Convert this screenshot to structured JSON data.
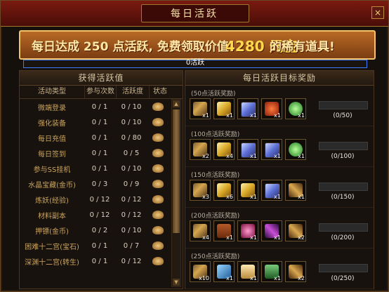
{
  "window": {
    "title": "每日活跃",
    "close_label": "×"
  },
  "banner": {
    "text_before": "每日达成 250 点活跃, 免费领取价值",
    "amount": "4280 元宝",
    "text_after": "的稀有道具!"
  },
  "activity_bar": {
    "label": "0活跃",
    "progress": 0
  },
  "left_panel": {
    "title": "获得活跃值",
    "columns": [
      "活动类型",
      "参与次数",
      "活跃度",
      "状态"
    ],
    "rows": [
      {
        "name": "微端登录",
        "count": "0 / 1",
        "activity": "0 / 10"
      },
      {
        "name": "强化装备",
        "count": "0 / 1",
        "activity": "0 / 10"
      },
      {
        "name": "每日充值",
        "count": "0 / 1",
        "activity": "0 / 80"
      },
      {
        "name": "每日签到",
        "count": "0 / 1",
        "activity": "0 / 5"
      },
      {
        "name": "参与SS挂机",
        "count": "0 / 1",
        "activity": "0 / 10"
      },
      {
        "name": "水晶宝藏(金币)",
        "count": "0 / 3",
        "activity": "0 / 9"
      },
      {
        "name": "炼妖(经验)",
        "count": "0 / 12",
        "activity": "0 / 12"
      },
      {
        "name": "材料副本",
        "count": "0 / 12",
        "activity": "0 / 12"
      },
      {
        "name": "押镖(金币)",
        "count": "0 / 2",
        "activity": "0 / 10"
      },
      {
        "name": "困难十二宫(宝石)",
        "count": "0 / 1",
        "activity": "0 / 7"
      },
      {
        "name": "深渊十二宫(转生)",
        "count": "0 / 1",
        "activity": "0 / 12"
      }
    ]
  },
  "right_panel": {
    "title": "每日活跃目标奖励",
    "tiers": [
      {
        "title": "(50点活跃奖励)",
        "progress_text": "(0/50)",
        "progress": 0,
        "items": [
          {
            "icon": "axe-icon",
            "qty": "x1"
          },
          {
            "icon": "gold-bar-icon",
            "qty": "x1"
          },
          {
            "icon": "scroll-icon",
            "qty": "x1"
          },
          {
            "icon": "money-bag-icon",
            "qty": "x1"
          },
          {
            "icon": "green-orb-icon",
            "qty": "x1"
          }
        ]
      },
      {
        "title": "(100点活跃奖励)",
        "progress_text": "(0/100)",
        "progress": 0,
        "items": [
          {
            "icon": "axe-icon",
            "qty": "x2"
          },
          {
            "icon": "gold-bar-icon",
            "qty": "x4"
          },
          {
            "icon": "blue-scroll-icon",
            "qty": "x1"
          },
          {
            "icon": "scroll-icon",
            "qty": "x1"
          },
          {
            "icon": "green-orb-icon",
            "qty": "x1"
          }
        ]
      },
      {
        "title": "(150点活跃奖励)",
        "progress_text": "(0/150)",
        "progress": 0,
        "items": [
          {
            "icon": "axe-icon",
            "qty": "x3"
          },
          {
            "icon": "gold-bar-icon",
            "qty": "x6"
          },
          {
            "icon": "gold-cloth-icon",
            "qty": "x1"
          },
          {
            "icon": "scroll-icon",
            "qty": "x1"
          },
          {
            "icon": "key-icon",
            "qty": "x1"
          }
        ]
      },
      {
        "title": "(200点活跃奖励)",
        "progress_text": "(0/200)",
        "progress": 0,
        "items": [
          {
            "icon": "axe-icon",
            "qty": "x4"
          },
          {
            "icon": "chest-icon",
            "qty": "x1"
          },
          {
            "icon": "gem-icon",
            "qty": "x1"
          },
          {
            "icon": "wand-icon",
            "qty": "x1"
          },
          {
            "icon": "key-icon",
            "qty": "x2"
          }
        ]
      },
      {
        "title": "(250点活跃奖励)",
        "progress_text": "(0/250)",
        "progress": 0,
        "items": [
          {
            "icon": "axe-icon",
            "qty": "x10"
          },
          {
            "icon": "crystal-icon",
            "qty": "x1"
          },
          {
            "icon": "bottle-icon",
            "qty": "x1"
          },
          {
            "icon": "potion-icon",
            "qty": "x1"
          },
          {
            "icon": "key-icon",
            "qty": "x2"
          }
        ]
      }
    ]
  }
}
